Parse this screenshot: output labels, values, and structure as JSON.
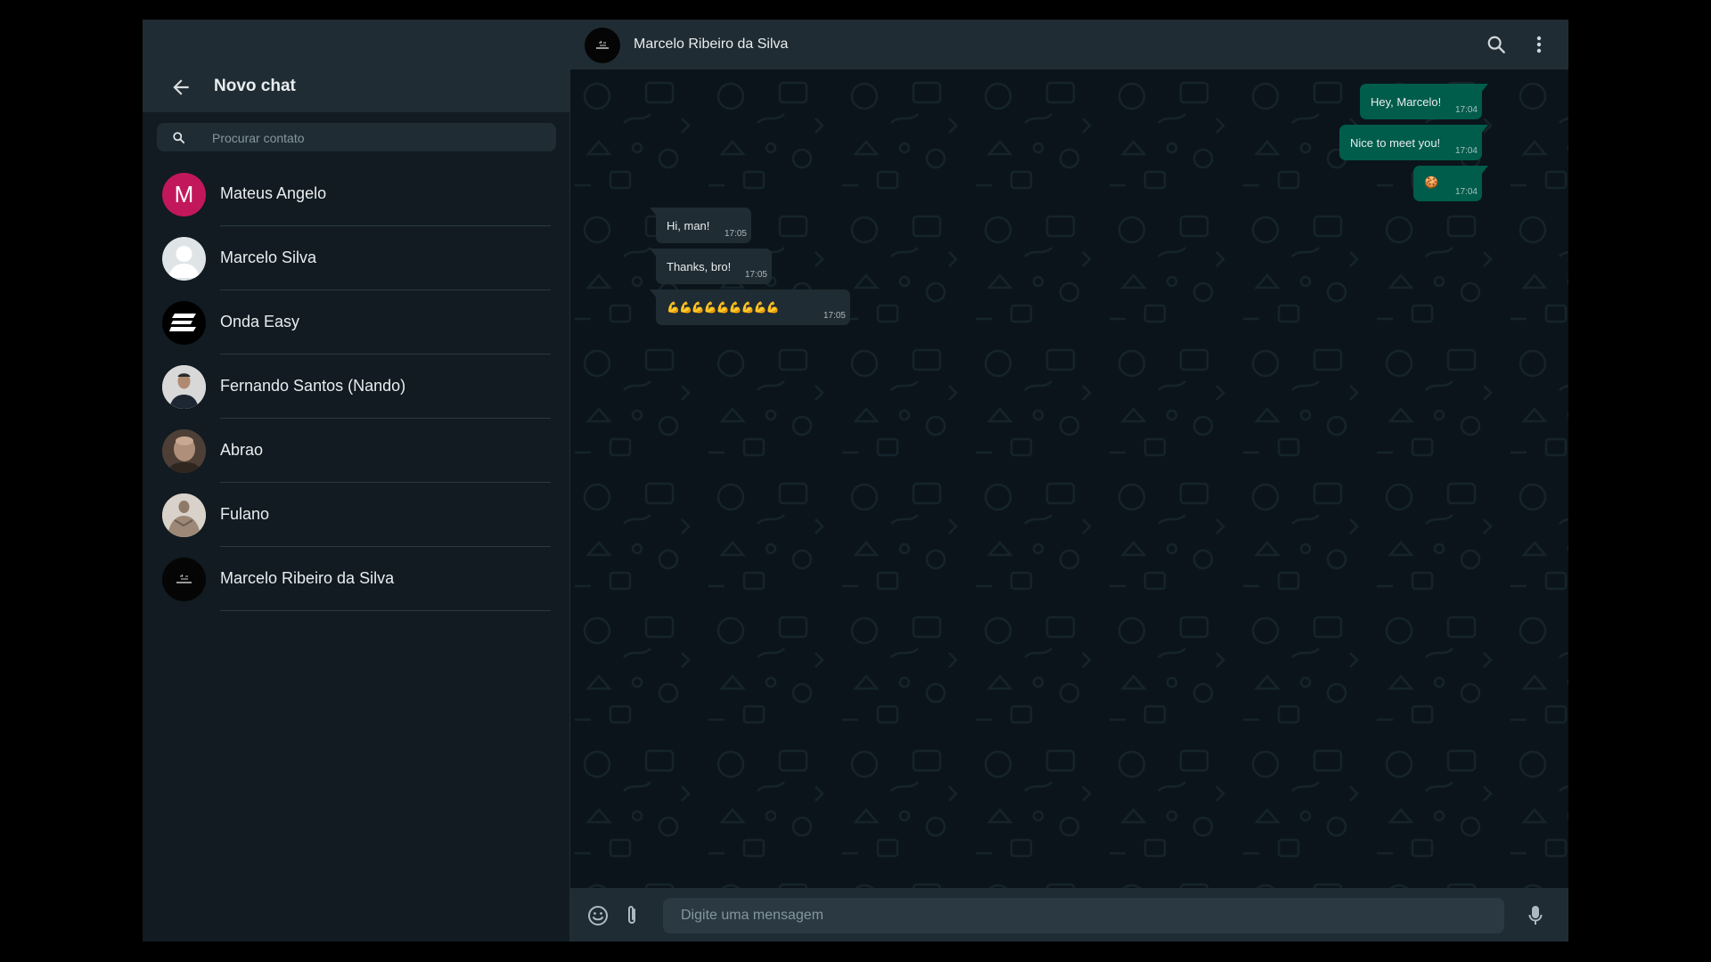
{
  "sidebar": {
    "title": "Novo chat",
    "search_placeholder": "Procurar contato",
    "contacts": [
      {
        "name": "Mateus Angelo",
        "initial": "M"
      },
      {
        "name": "Marcelo Silva"
      },
      {
        "name": "Onda Easy"
      },
      {
        "name": "Fernando Santos (Nando)"
      },
      {
        "name": "Abrao"
      },
      {
        "name": "Fulano"
      },
      {
        "name": "Marcelo Ribeiro da Silva"
      }
    ]
  },
  "chat": {
    "contact_name": "Marcelo Ribeiro da Silva",
    "messages": [
      {
        "direction": "out",
        "text": "Hey, Marcelo!",
        "time": "17:04"
      },
      {
        "direction": "out",
        "text": "Nice to meet you!",
        "time": "17:04"
      },
      {
        "direction": "out",
        "text": "🍪",
        "time": "17:04"
      },
      {
        "direction": "in",
        "text": "Hi, man!",
        "time": "17:05"
      },
      {
        "direction": "in",
        "text": "Thanks, bro!",
        "time": "17:05"
      },
      {
        "direction": "in",
        "text": "💪💪💪💪💪💪💪💪💪",
        "time": "17:05"
      }
    ],
    "input_placeholder": "Digite uma mensagem"
  },
  "colors": {
    "outgoing_bubble": "#005c4b",
    "incoming_bubble": "#202c33",
    "panel_header": "#202c33",
    "chat_background": "#0b141a",
    "avatar_accent": "#c2185b"
  },
  "icons": [
    "back-arrow-icon",
    "search-icon",
    "menu-dots-icon",
    "emoji-icon",
    "attach-clip-icon",
    "microphone-icon"
  ]
}
